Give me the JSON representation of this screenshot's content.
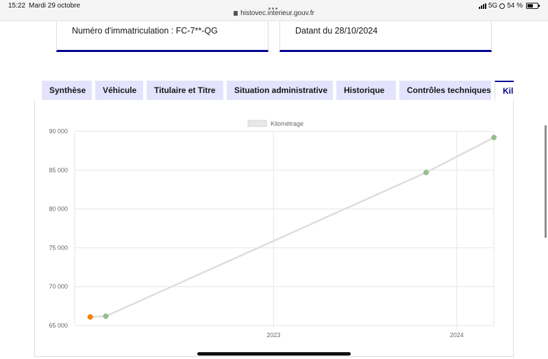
{
  "status_bar": {
    "time": "15:22",
    "date": "Mardi 29 octobre",
    "url": "histovec.interieur.gouv.fr",
    "network": "5G",
    "battery": "54 %",
    "battery_level": 0.54,
    "icons": [
      "lock-icon",
      "signal-icon",
      "rotation-lock-icon",
      "battery-icon"
    ]
  },
  "info": {
    "registration": "Numéro d'immatriculation : FC-7**-QG",
    "date_label": "Datant du 28/10/2024"
  },
  "tabs": [
    {
      "label": "Synthèse",
      "active": false
    },
    {
      "label": "Véhicule",
      "active": false
    },
    {
      "label": "Titulaire et Titre",
      "active": false
    },
    {
      "label": "Situation administrative",
      "active": false
    },
    {
      "label": "Historique",
      "active": false
    },
    {
      "label": "Contrôles techniques",
      "active": false
    },
    {
      "label": "Kilo",
      "active": true
    }
  ],
  "colors": {
    "accent": "#000091",
    "tab_bg": "#e3e3fd",
    "line": "#dddddd",
    "point": "#94bf8b",
    "first_point": "#f5820d"
  },
  "chart_data": {
    "type": "line",
    "legend": [
      "Kilométrage"
    ],
    "legend_position": "top",
    "grid": true,
    "series": [
      {
        "name": "Kilométrage",
        "points": [
          {
            "x": "2022-01-01",
            "y": 66100
          },
          {
            "x": "2022-02-01",
            "y": 66200
          },
          {
            "x": "2023-11-01",
            "y": 84700
          },
          {
            "x": "2024-03-15",
            "y": 89200
          }
        ]
      }
    ],
    "xlim": [
      "2021-12-01",
      "2024-03-15"
    ],
    "ylim": [
      65000,
      90000
    ],
    "x_ticks": [
      "2023",
      "2024"
    ],
    "y_ticks": [
      "65 000",
      "70 000",
      "75 000",
      "80 000",
      "85 000",
      "90 000"
    ]
  }
}
